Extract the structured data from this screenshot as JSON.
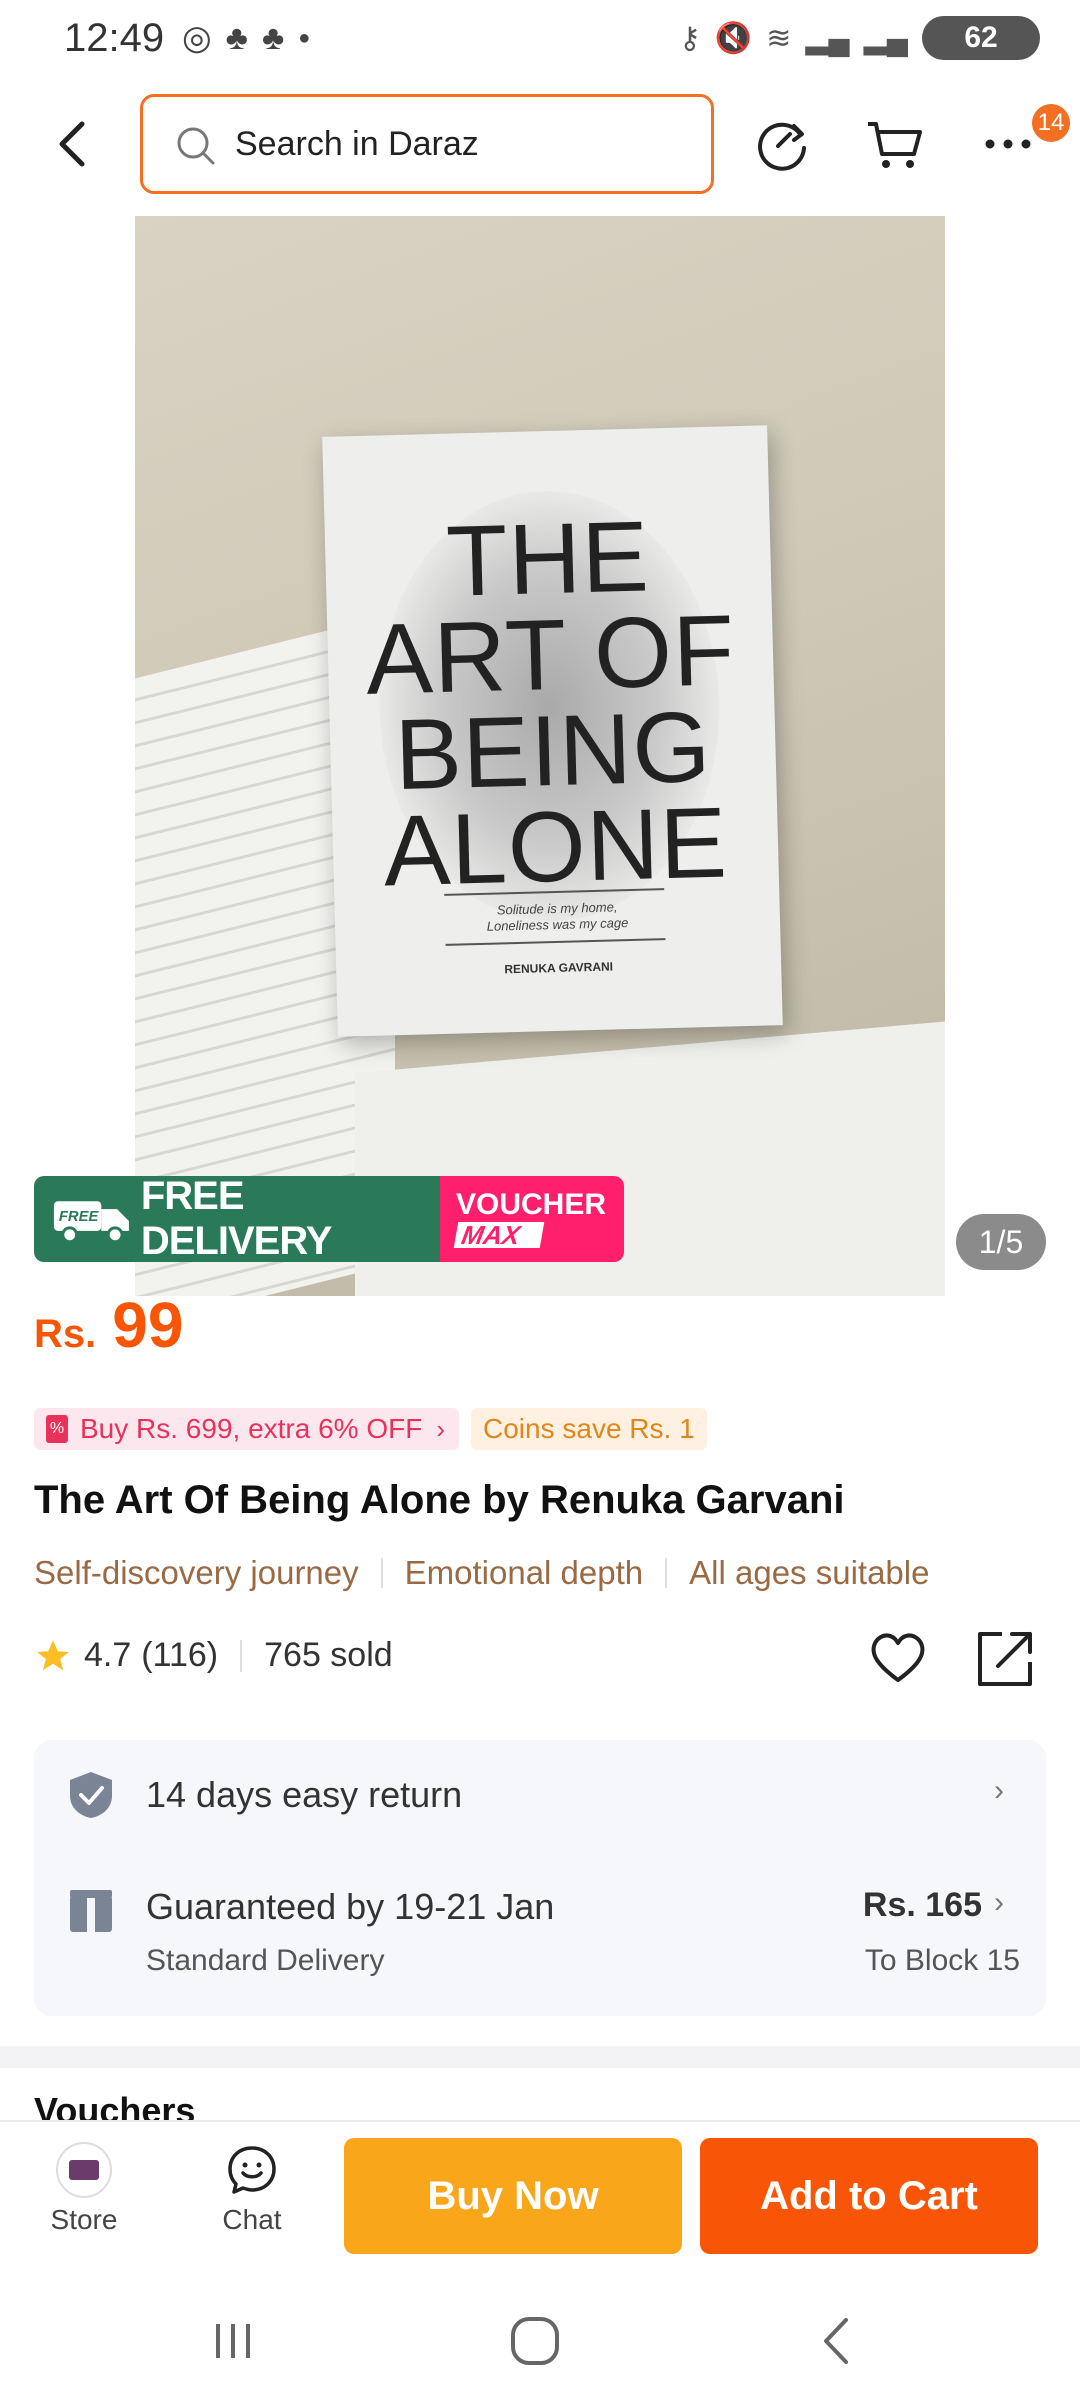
{
  "status_bar": {
    "time": "12:49",
    "battery": "62"
  },
  "header": {
    "search_placeholder": "Search in Daraz",
    "more_badge": "14"
  },
  "gallery": {
    "counter": "1/5",
    "book_cover": {
      "title_lines": [
        "THE",
        "ART OF",
        "BEING",
        "ALONE"
      ],
      "subtitle_line1": "Solitude is my home,",
      "subtitle_line2": "Loneliness was my cage",
      "author": "RENUKA GAVRANI"
    },
    "promo": {
      "free_tag": "FREE",
      "free_delivery": "FREE DELIVERY",
      "voucher": "VOUCHER",
      "voucher_max": "MAX"
    }
  },
  "price": {
    "currency": "Rs.",
    "value": "99",
    "color": "#f85606"
  },
  "tags": {
    "deal": "Buy Rs. 699, extra 6% OFF",
    "coins": "Coins save Rs. 1"
  },
  "product": {
    "title": "The Art Of Being Alone  by Renuka Garvani",
    "highlights": [
      "Self-discovery journey",
      "Emotional depth",
      "All ages suitable"
    ]
  },
  "rating": {
    "score": "4.7",
    "count": "(116)",
    "sold": "765 sold"
  },
  "services": {
    "return": "14 days easy return",
    "delivery_guarantee": "Guaranteed by 19-21 Jan",
    "delivery_type": "Standard Delivery",
    "delivery_fee": "Rs. 165",
    "delivery_dest": "To Block 15"
  },
  "next_section": "Vouchers",
  "action_bar": {
    "store_label": "Store",
    "chat_label": "Chat",
    "buy_now": "Buy Now",
    "add_to_cart": "Add to Cart"
  },
  "colors": {
    "brand_orange": "#f85606",
    "buy_now_yellow": "#faa61a",
    "search_border": "#f36f21",
    "promo_green": "#2a7a5a",
    "promo_pink": "#ff1f6d"
  }
}
